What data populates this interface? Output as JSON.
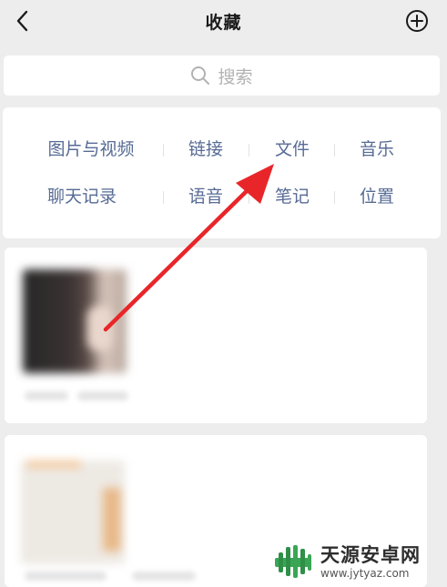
{
  "header": {
    "title": "收藏",
    "back_icon": "chevron-left-icon",
    "add_icon": "plus-circle-icon"
  },
  "search": {
    "placeholder": "搜索",
    "icon": "search-icon"
  },
  "categories": [
    [
      "图片与视频",
      "链接",
      "文件",
      "音乐"
    ],
    [
      "聊天记录",
      "语音",
      "笔记",
      "位置"
    ]
  ],
  "annotation": {
    "type": "red-arrow",
    "color": "#e8262a",
    "target": "文件"
  },
  "watermark": {
    "title": "天源安卓网",
    "url": "www.jytyaz.com",
    "accent": "#3aa655"
  },
  "colors": {
    "link": "#576b95",
    "background": "#ededed"
  }
}
